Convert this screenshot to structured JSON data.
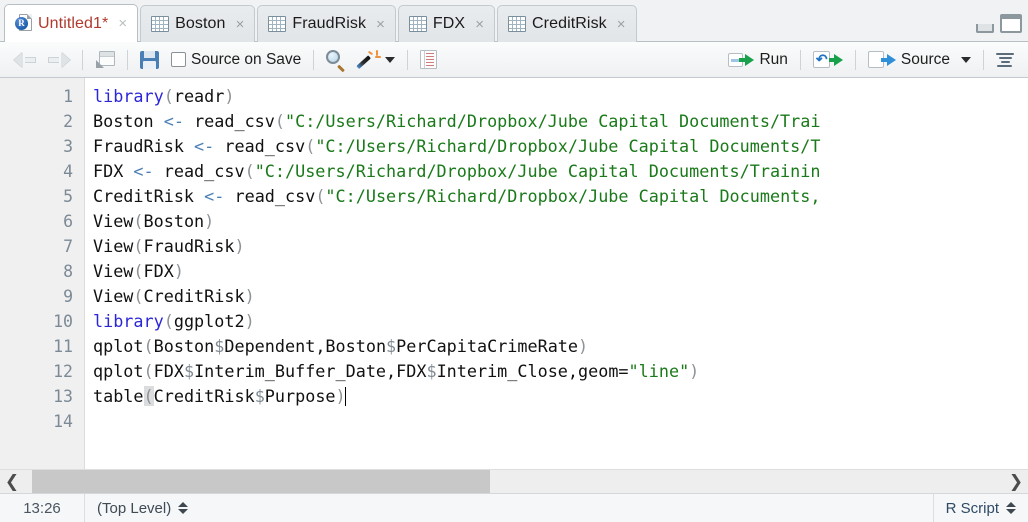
{
  "window": {
    "minimize_label": "Minimize",
    "maximize_label": "Maximize"
  },
  "tabs": [
    {
      "label": "Untitled1*",
      "icon": "r-script-icon",
      "active": true,
      "close": "×"
    },
    {
      "label": "Boston",
      "icon": "data-frame-icon",
      "active": false,
      "close": "×"
    },
    {
      "label": "FraudRisk",
      "icon": "data-frame-icon",
      "active": false,
      "close": "×"
    },
    {
      "label": "FDX",
      "icon": "data-frame-icon",
      "active": false,
      "close": "×"
    },
    {
      "label": "CreditRisk",
      "icon": "data-frame-icon",
      "active": false,
      "close": "×"
    }
  ],
  "toolbar": {
    "back_icon": "back-arrow-icon",
    "forward_icon": "forward-arrow-icon",
    "popout_icon": "show-in-new-window-icon",
    "save_icon": "save-icon",
    "source_on_save_label": "Source on Save",
    "find_icon": "find-replace-magnifier-icon",
    "wand_icon": "code-tools-wand-icon",
    "compile_report_icon": "compile-report-notebook-icon",
    "run_label": "Run",
    "run_icon": "run-icon",
    "rerun_icon": "rerun-previous-icon",
    "source_label": "Source",
    "source_icon": "source-icon",
    "outline_icon": "document-outline-icon"
  },
  "editor": {
    "line_numbers": [
      "1",
      "2",
      "3",
      "4",
      "5",
      "6",
      "7",
      "8",
      "9",
      "10",
      "11",
      "12",
      "13",
      "14"
    ],
    "lines": [
      {
        "n": "1",
        "text": "library(readr)"
      },
      {
        "n": "2",
        "text": "Boston <- read_csv(\"C:/Users/Richard/Dropbox/Jube Capital Documents/Trai"
      },
      {
        "n": "3",
        "text": "FraudRisk <- read_csv(\"C:/Users/Richard/Dropbox/Jube Capital Documents/T"
      },
      {
        "n": "4",
        "text": "FDX <- read_csv(\"C:/Users/Richard/Dropbox/Jube Capital Documents/Trainin"
      },
      {
        "n": "5",
        "text": "CreditRisk <- read_csv(\"C:/Users/Richard/Dropbox/Jube Capital Documents,"
      },
      {
        "n": "6",
        "text": "View(Boston)"
      },
      {
        "n": "7",
        "text": "View(FraudRisk)"
      },
      {
        "n": "8",
        "text": "View(FDX)"
      },
      {
        "n": "9",
        "text": "View(CreditRisk)"
      },
      {
        "n": "10",
        "text": "library(ggplot2)"
      },
      {
        "n": "11",
        "text": "qplot(Boston$Dependent,Boston$PerCapitaCrimeRate)"
      },
      {
        "n": "12",
        "text": "qplot(FDX$Interim_Buffer_Date,FDX$Interim_Close,geom=\"line\")"
      },
      {
        "n": "13",
        "text": "table(CreditRisk$Purpose)"
      },
      {
        "n": "14",
        "text": ""
      }
    ],
    "tokens": {
      "l1": {
        "kw": "library",
        "open": "(",
        "arg": "readr",
        "close": ")"
      },
      "l2": {
        "var": "Boston",
        "assign": "<-",
        "fn": "read_csv",
        "str": "\"C:/Users/Richard/Dropbox/Jube Capital Documents/Trai"
      },
      "l3": {
        "var": "FraudRisk",
        "assign": "<-",
        "fn": "read_csv",
        "str": "\"C:/Users/Richard/Dropbox/Jube Capital Documents/T"
      },
      "l4": {
        "var": "FDX",
        "assign": "<-",
        "fn": "read_csv",
        "str": "\"C:/Users/Richard/Dropbox/Jube Capital Documents/Trainin"
      },
      "l5": {
        "var": "CreditRisk",
        "assign": "<-",
        "fn": "read_csv",
        "str": "\"C:/Users/Richard/Dropbox/Jube Capital Documents,"
      },
      "l6": {
        "fn": "View",
        "arg": "Boston"
      },
      "l7": {
        "fn": "View",
        "arg": "FraudRisk"
      },
      "l8": {
        "fn": "View",
        "arg": "FDX"
      },
      "l9": {
        "fn": "View",
        "arg": "CreditRisk"
      },
      "l10": {
        "kw": "library",
        "arg": "ggplot2"
      },
      "l11": {
        "fn": "qplot",
        "a1": "Boston",
        "d1": "$",
        "f1": "Dependent",
        "a2": "Boston",
        "d2": "$",
        "f2": "PerCapitaCrimeRate"
      },
      "l12": {
        "fn": "qplot",
        "a1": "FDX",
        "d1": "$",
        "f1": "Interim_Buffer_Date",
        "a2": "FDX",
        "d2": "$",
        "f2": "Interim_Close",
        "kwarg": "geom=",
        "str": "\"line\""
      },
      "l13": {
        "fn": "table",
        "a1": "CreditRisk",
        "d1": "$",
        "f1": "Purpose"
      }
    }
  },
  "hscroll": {
    "left_arrow": "❮",
    "right_arrow": "❯"
  },
  "statusbar": {
    "cursor_position": "13:26",
    "scope": "(Top Level)",
    "file_type": "R Script"
  },
  "colors": {
    "keyword": "#2b27d8",
    "string": "#1a7a1a",
    "paren": "#8d9398",
    "active_tab_text": "#b03a2e",
    "gutter_text": "#7c8a96"
  }
}
